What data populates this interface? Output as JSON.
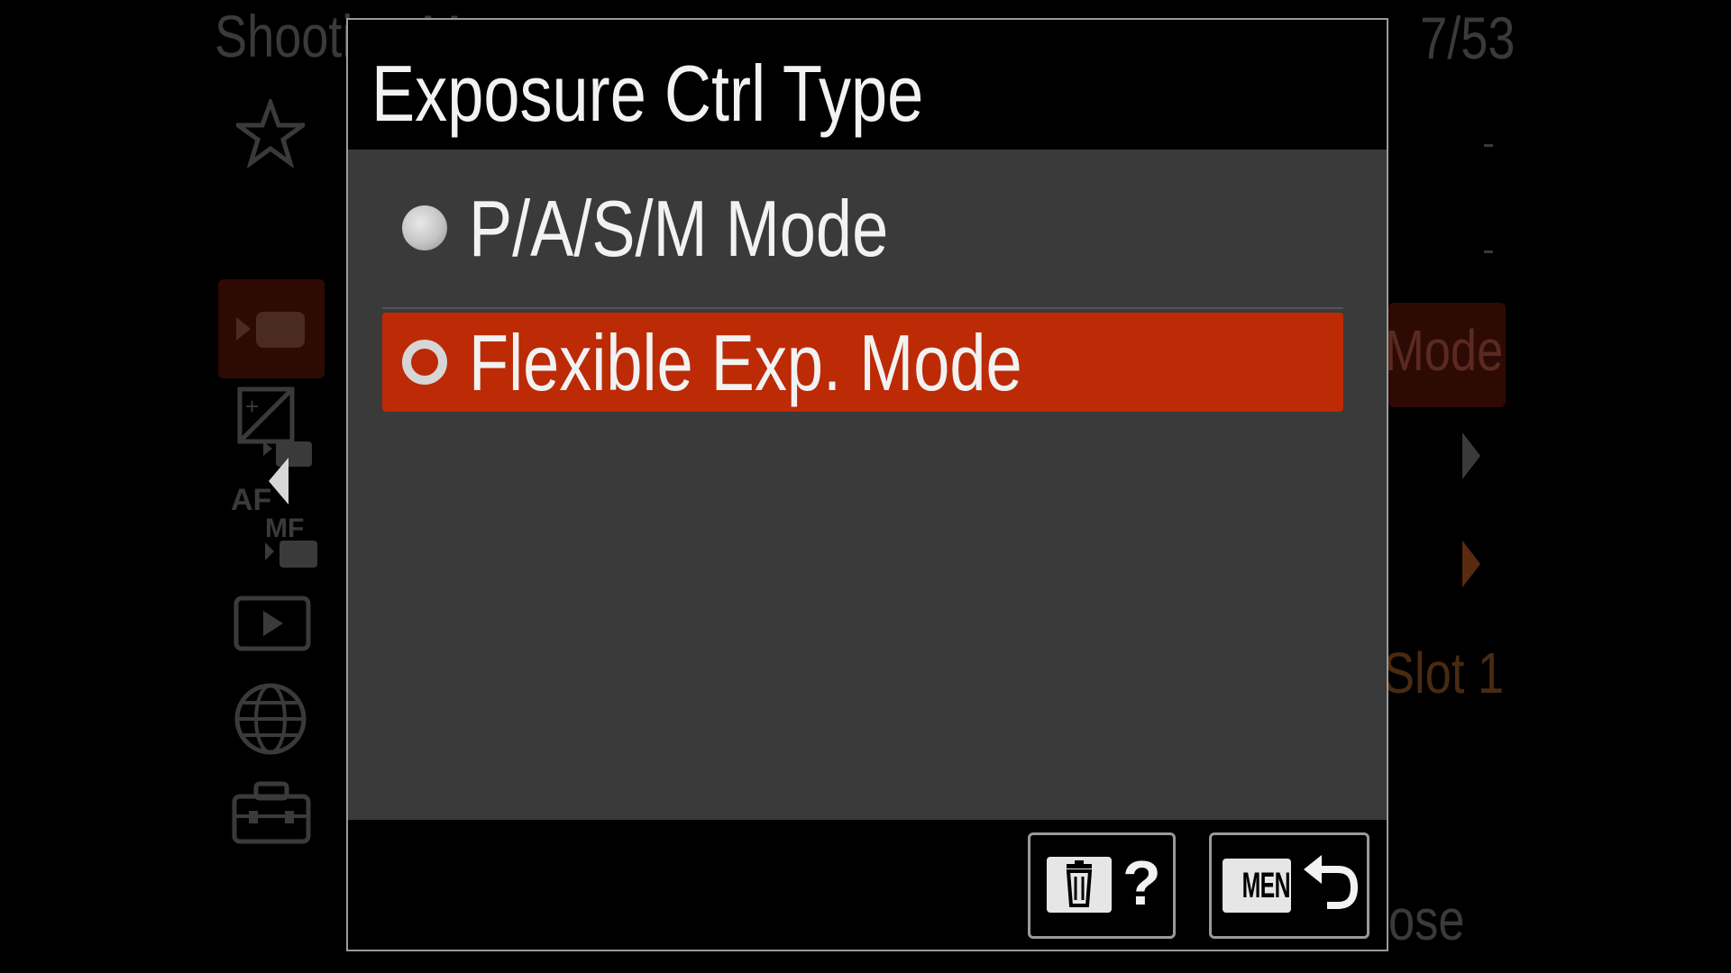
{
  "background_menu": {
    "title": "Shooting Menu",
    "page": "7/53",
    "items": [
      {
        "text": "Mode"
      },
      {
        "text": "Slot 1"
      },
      {
        "text": "ose"
      }
    ],
    "icons": [
      "star-icon",
      "movie-camera-icon",
      "exposure-comp-icon",
      "af-mf-icon",
      "playback-icon",
      "globe-icon",
      "toolbox-icon"
    ]
  },
  "dialog": {
    "title": "Exposure Ctrl Type",
    "options": [
      {
        "label": "P/A/S/M Mode",
        "selected": false
      },
      {
        "label": "Flexible Exp. Mode",
        "selected": true
      }
    ],
    "footer": {
      "delete_help_label": "?",
      "menu_label": "MENU",
      "icons": [
        "trash-icon",
        "help-icon",
        "back-arrow-icon"
      ]
    }
  },
  "colors": {
    "accent": "#bd2a06",
    "panel": "#3a3a3a",
    "text": "#f2f2f2"
  }
}
